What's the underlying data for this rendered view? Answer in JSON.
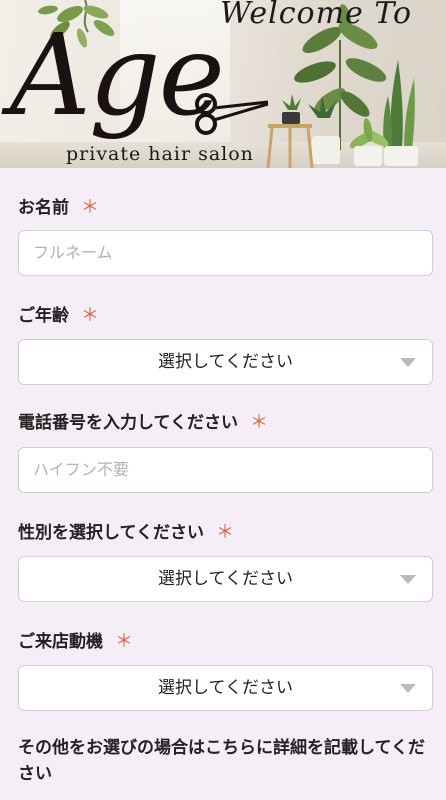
{
  "header": {
    "welcome": "Welcome To",
    "brand": "Age",
    "tagline": "private hair salon"
  },
  "form": {
    "required_mark": "＊",
    "name": {
      "label": "お名前",
      "placeholder": "フルネーム"
    },
    "age": {
      "label": "ご年齢",
      "selected": "選択してください"
    },
    "phone": {
      "label": "電話番号を入力してください",
      "placeholder": "ハイフン不要"
    },
    "gender": {
      "label": "性別を選択してください",
      "selected": "選択してください"
    },
    "motive": {
      "label": "ご来店動機",
      "selected": "選択してください"
    },
    "other_label": "その他をお選びの場合はこちらに詳細を記載してください"
  },
  "colors": {
    "page_bg": "#f6eef6",
    "required": "#e0644b",
    "caret": "#b9b9be"
  }
}
